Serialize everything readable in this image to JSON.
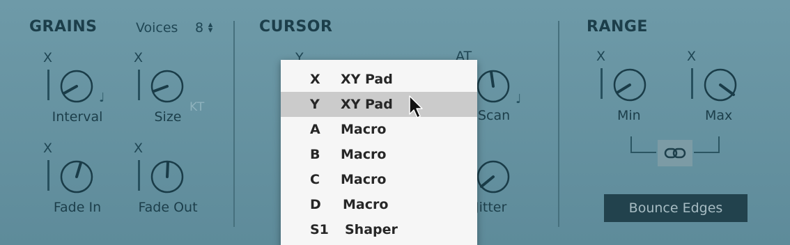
{
  "grains": {
    "title": "GRAINS",
    "voices_label": "Voices",
    "voices_value": "8",
    "knobs": {
      "interval": {
        "label": "Interval",
        "mod": "X"
      },
      "size": {
        "label": "Size",
        "mod": "X",
        "kt": "KT"
      },
      "fade_in": {
        "label": "Fade In",
        "mod": "X"
      },
      "fade_out": {
        "label": "Fade Out",
        "mod": "X"
      }
    }
  },
  "cursor": {
    "title": "CURSOR",
    "mod_y": "Y",
    "mod_at": "AT",
    "scan_label": "Scan",
    "jitter_label": "Jitter"
  },
  "range": {
    "title": "RANGE",
    "min": {
      "label": "Min",
      "mod": "X"
    },
    "max": {
      "label": "Max",
      "mod": "X"
    },
    "bounce_label": "Bounce Edges"
  },
  "menu": {
    "items": [
      {
        "key": "X",
        "name": "XY Pad"
      },
      {
        "key": "Y",
        "name": "XY Pad"
      },
      {
        "key": "A",
        "name": "Macro"
      },
      {
        "key": "B",
        "name": "Macro"
      },
      {
        "key": "C",
        "name": "Macro"
      },
      {
        "key": "D",
        "name": "Macro"
      },
      {
        "key": "S1",
        "name": "Shaper"
      }
    ],
    "selected_index": 1
  },
  "icons": {
    "note": "note-icon",
    "link": "link-icon",
    "stepper": "stepper-icon",
    "cursor": "mouse-pointer-icon"
  },
  "colors": {
    "panel_bg": "#6e9aa8",
    "dark_text": "#1c3e4a",
    "menu_bg": "#f6f6f6",
    "menu_selected": "#cbcbcb",
    "button_bg": "#22424d"
  }
}
